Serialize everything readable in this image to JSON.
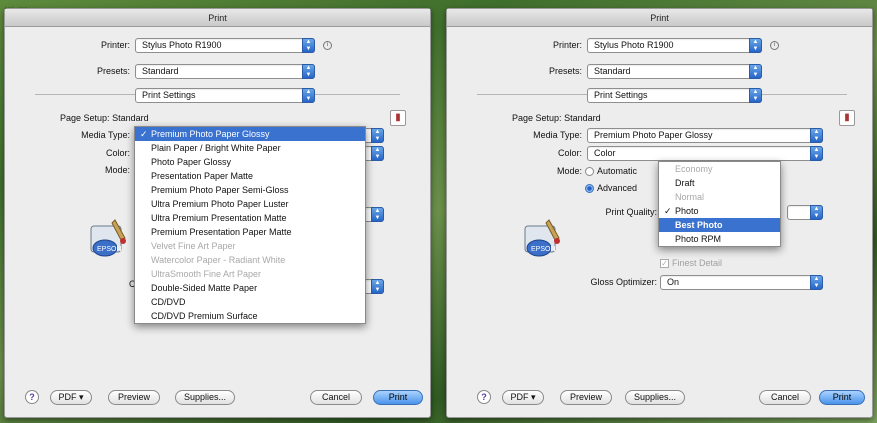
{
  "caption": "... ...",
  "left_dialog": {
    "title": "Print",
    "printer_label": "Printer:",
    "printer_value": "Stylus Photo R1900",
    "presets_label": "Presets:",
    "presets_value": "Standard",
    "panel_value": "Print Settings",
    "page_setup_label": "Page Setup:",
    "page_setup_value": "Standard",
    "media_type_label": "Media Type:",
    "color_label": "Color:",
    "mode_label": "Mode:",
    "partial_letter": "C",
    "media_menu": [
      {
        "label": "Premium Photo Paper Glossy",
        "state": "selected"
      },
      {
        "label": "Plain Paper / Bright White Paper",
        "state": "enabled"
      },
      {
        "label": "Photo Paper Glossy",
        "state": "enabled"
      },
      {
        "label": "Presentation Paper Matte",
        "state": "enabled"
      },
      {
        "label": "Premium Photo Paper Semi-Gloss",
        "state": "enabled"
      },
      {
        "label": "Ultra Premium Photo Paper Luster",
        "state": "enabled"
      },
      {
        "label": "Ultra Premium Presentation Matte",
        "state": "enabled"
      },
      {
        "label": "Premium Presentation Paper Matte",
        "state": "enabled"
      },
      {
        "label": "Velvet Fine Art Paper",
        "state": "disabled"
      },
      {
        "label": "Watercolor Paper - Radiant White",
        "state": "disabled"
      },
      {
        "label": "UltraSmooth Fine Art Paper",
        "state": "disabled"
      },
      {
        "label": "Double-Sided Matte Paper",
        "state": "enabled"
      },
      {
        "label": "CD/DVD",
        "state": "enabled"
      },
      {
        "label": "CD/DVD Premium Surface",
        "state": "enabled"
      }
    ],
    "help": "?",
    "pdf_label": "PDF ▾",
    "preview_label": "Preview",
    "supplies_label": "Supplies...",
    "cancel_label": "Cancel",
    "print_label": "Print"
  },
  "right_dialog": {
    "title": "Print",
    "printer_label": "Printer:",
    "printer_value": "Stylus Photo R1900",
    "presets_label": "Presets:",
    "presets_value": "Standard",
    "panel_value": "Print Settings",
    "page_setup_label": "Page Setup:",
    "page_setup_value": "Standard",
    "media_type_label": "Media Type:",
    "media_type_value": "Premium Photo Paper Glossy",
    "color_label": "Color:",
    "color_value": "Color",
    "mode_label": "Mode:",
    "automatic_label": "Automatic",
    "advanced_label": "Advanced",
    "print_quality_label": "Print Quality:",
    "quality_menu": [
      {
        "label": "Economy",
        "state": "disabled"
      },
      {
        "label": "Draft",
        "state": "enabled"
      },
      {
        "label": "Normal",
        "state": "disabled"
      },
      {
        "label": "Photo",
        "state": "checked"
      },
      {
        "label": "Best Photo",
        "state": "highlighted"
      },
      {
        "label": "Photo RPM",
        "state": "enabled"
      }
    ],
    "finest_detail_label": "Finest Detail",
    "gloss_label": "Gloss Optimizer:",
    "gloss_value": "On",
    "help": "?",
    "pdf_label": "PDF ▾",
    "preview_label": "Preview",
    "supplies_label": "Supplies...",
    "cancel_label": "Cancel",
    "print_label": "Print"
  },
  "icons": {
    "popup_arrows": "↕",
    "check": "✓",
    "info": "i",
    "ink": "▮"
  },
  "colors": {
    "highlight": "#3a72d0",
    "default_button": "#4b93ea"
  }
}
